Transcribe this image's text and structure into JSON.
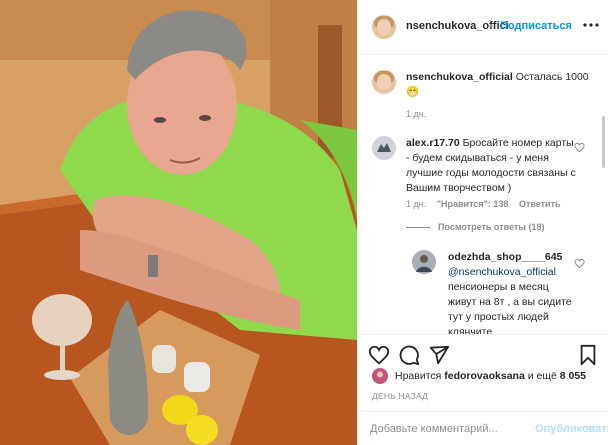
{
  "post_header": {
    "username": "nsenchukova_offici",
    "separator": "•",
    "follow_label": "Подписаться"
  },
  "caption": {
    "username": "nsenchukova_official",
    "text": "Осталась 1000",
    "emoji": "😁",
    "time": "1 дн."
  },
  "comments": [
    {
      "username": "alex.r17.70",
      "text": "Бросайте номер карты - будем скидываться - у меня лучшие годы молодости связаны с Вашим творчеством )",
      "time": "1 дн.",
      "likes": "\"Нравится\": 138",
      "reply": "Ответить",
      "view_replies": "Посмотреть ответы (18)"
    },
    {
      "username": "odezhda_shop____645",
      "mention": "@nsenchukova_official",
      "text": "пенсионеры в месяц живут на 8т , а вы сидите тут у простых людей клянчите"
    }
  ],
  "likes_bar": {
    "prefix": "Нравится",
    "user": "fedorovaoksana",
    "middle": "и ещё",
    "count": "8 055"
  },
  "date_label": "ДЕНЬ НАЗАД",
  "add_comment": {
    "placeholder": "Добавьте комментарий...",
    "post_label": "Опубликовать"
  },
  "colors": {
    "accent": "#0095f6",
    "muted": "#8e8e8e",
    "post_disabled": "#b2dffc",
    "shirt": "#8bd84a",
    "table": "#b5521f"
  },
  "icons": [
    "heart-icon",
    "comment-icon",
    "share-icon",
    "bookmark-icon",
    "more-icon"
  ]
}
